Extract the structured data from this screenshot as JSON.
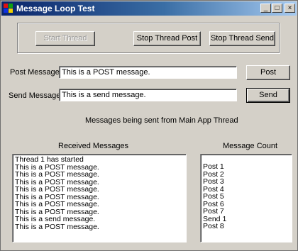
{
  "window": {
    "title": "Message Loop Test"
  },
  "caption_buttons": {
    "minimize": "_",
    "maximize": "□",
    "close": "×"
  },
  "thread_controls": {
    "start_thread": "Start Thread",
    "stop_thread_post": "Stop Thread Post",
    "stop_thread_send": "Stop Thread Send"
  },
  "post_row": {
    "label": "Post Message",
    "value": "This is a POST message.",
    "button": "Post"
  },
  "send_row": {
    "label": "Send Message",
    "value": "This is a send message.",
    "button": "Send"
  },
  "status_text": "Messages being sent from Main App Thread",
  "received": {
    "label": "Received Messages",
    "items": [
      "Thread 1 has started",
      "This is a POST message.",
      "This is a POST message.",
      "This is a POST message.",
      "This is a POST message.",
      "This is a POST message.",
      "This is a POST message.",
      "This is a POST message.",
      "This is a send message.",
      "This is a POST message."
    ]
  },
  "count": {
    "label": "Message Count",
    "items": [
      "Post 1",
      "Post 2",
      "Post 3",
      "Post 4",
      "Post 5",
      "Post 6",
      "Post 7",
      "Send 1",
      "Post 8"
    ]
  },
  "colors": {
    "titlebar_start": "#0a246a",
    "titlebar_end": "#a6caf0",
    "window_bg": "#d4d0c8"
  }
}
